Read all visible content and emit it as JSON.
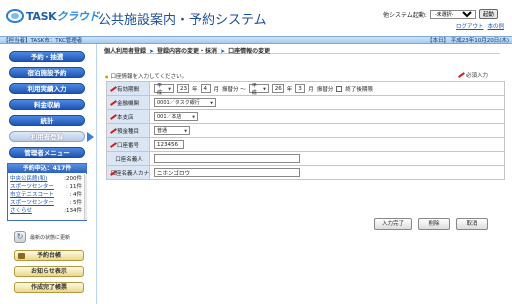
{
  "header": {
    "logo_main": "TASK",
    "logo_accent": "クラウド",
    "title": "公共施設案内・予約システム",
    "launcher_label": "他システム起動:",
    "launcher_selected": "-未選択-",
    "launch_button": "起動",
    "links": [
      "ログアウト",
      "本の例"
    ]
  },
  "info_bar": {
    "left": "【担当者】TASK市：TKC管理者",
    "right": "【本日】 平成23年10月20日(木)"
  },
  "sidebar": {
    "menu": [
      "予約・抽選",
      "宿泊施設予約",
      "利用実績入力",
      "料金収納",
      "統計",
      "利用者登録",
      "管理者メニュー"
    ],
    "pending": {
      "title": "予約申込：417件",
      "items": [
        {
          "label": "中央公民館(和)",
          "count": ":200件"
        },
        {
          "label": "スポーツセンター",
          "count": ":  11件"
        },
        {
          "label": "市立テニスコート",
          "count": ":   4件"
        },
        {
          "label": "スポーツセンター",
          "count": ":   5件"
        },
        {
          "label": "さくらせ",
          "count": ":134件"
        }
      ]
    },
    "refresh_label": "最新の状態に更新",
    "sub_buttons": [
      "予約台帳",
      "お知らせ表示",
      "作成完了帳票"
    ]
  },
  "breadcrumb": [
    "個人利用者登録",
    "登録内容の変更・抹消",
    "口座情報の変更"
  ],
  "instruction": "口座情報を入力してください。",
  "required_legend": "必須入力",
  "form": {
    "period": {
      "label": "有効期間",
      "era_from": "平成",
      "year_from": "23",
      "year_unit": "年",
      "month_from": "4",
      "month_unit": "月",
      "suffix_from": "振替分 ～",
      "era_to": "平成",
      "year_to": "26",
      "month_to": "3",
      "suffix_to": "振替分",
      "end_check_label": "終了後期限"
    },
    "bank": {
      "label": "金融機関",
      "value": "0001／タスク銀行"
    },
    "branch": {
      "label": "本支店",
      "value": "001／本店"
    },
    "account_type": {
      "label": "預金種目",
      "value": "普通"
    },
    "account_number": {
      "label": "口座番号",
      "value": "123456"
    },
    "holder_name": {
      "label": "口座名義人",
      "value": ""
    },
    "holder_kana": {
      "label": "口座名義人カナ",
      "value": "ニホンゴロウ"
    }
  },
  "buttons": {
    "complete": "入力完了",
    "delete": "削除",
    "cancel": "取消"
  }
}
